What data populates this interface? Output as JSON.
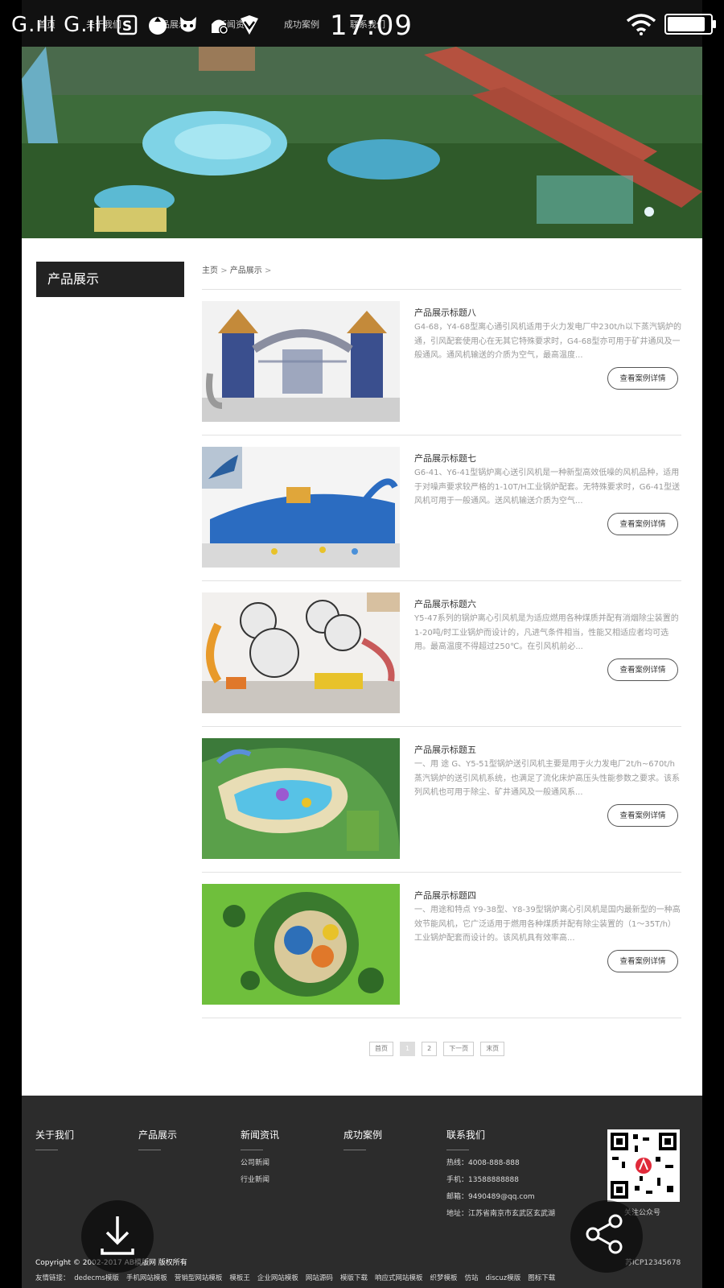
{
  "status_bar": {
    "signal1": "G.ıll",
    "signal2": "G.ıll",
    "time": "17:09",
    "battery_level": 0.95
  },
  "nav": {
    "items": [
      "首页",
      "关于我们",
      "产品展示",
      "新闻资讯",
      "成功案例",
      "联系我们"
    ]
  },
  "sidebar": {
    "title": "产品展示"
  },
  "breadcrumb": {
    "home": "主页",
    "sep": ">",
    "current": "产品展示",
    "trail": ">"
  },
  "products": [
    {
      "title": "产品展示标题八",
      "desc": "G4-68，Y4-68型离心通引风机适用于火力发电厂中230t/h以下蒸汽锅炉的通，引风配套使用心在无其它特殊要求时，G4-68型亦可用于矿井通风及一般通风。通风机输送的介质为空气，最高温度...",
      "button": "查看案例详情"
    },
    {
      "title": "产品展示标题七",
      "desc": "G6-41、Y6-41型锅炉离心送引风机是一种新型高效低噪的风机品种，适用于对噪声要求较严格的1-10T/H工业锅炉配套。无特殊要求时，G6-41型送风机可用于一般通风。送风机输送介质为空气...",
      "button": "查看案例详情"
    },
    {
      "title": "产品展示标题六",
      "desc": "Y5-47系列的锅炉离心引风机是为适应燃用各种煤质并配有消烟除尘装置的1-20吨/时工业锅炉而设计的，凡进气条件相当，性能又相适应者均可选用。最高温度不得超过250℃。在引风机前必...",
      "button": "查看案例详情"
    },
    {
      "title": "产品展示标题五",
      "desc": "一、用 途 G、Y5-51型锅炉送引风机主要是用于火力发电厂2t/h~670t/h蒸汽锅炉的送引风机系统，也满足了流化床炉高压头性能参数之要求。该系列风机也可用于除尘、矿井通风及一般通风系...",
      "button": "查看案例详情"
    },
    {
      "title": "产品展示标题四",
      "desc": "一、用途和特点 Y9-38型、Y8-39型锅炉离心引风机是国内最新型的一种高效节能风机，它广泛适用于燃用各种煤质并配有除尘装置的（1～35T/h）工业锅炉配套而设计的。该风机具有效率高...",
      "button": "查看案例详情"
    }
  ],
  "pagination": [
    "首页",
    "1",
    "2",
    "下一页",
    "末页"
  ],
  "footer": {
    "cols": [
      {
        "heading": "关于我们",
        "items": []
      },
      {
        "heading": "产品展示",
        "items": []
      },
      {
        "heading": "新闻资讯",
        "items": [
          "公司新闻",
          "行业新闻"
        ]
      },
      {
        "heading": "成功案例",
        "items": []
      },
      {
        "heading": "联系我们",
        "items": [
          "热线：4008-888-888",
          "手机：13588888888",
          "邮箱：9490489@qq.com",
          "地址：江苏省南京市玄武区玄武湖"
        ]
      }
    ],
    "qr_label": "关注公众号",
    "copyright": "Copyright © 2002-2017 AB模版网 版权所有",
    "icp": "苏ICP12345678",
    "friend_links_label": "友情链接：",
    "friend_links": [
      "dedecms模版",
      "手机网站模板",
      "营销型网站模板",
      "模板王",
      "企业网站模板",
      "网站源码",
      "模版下载",
      "响应式网站模板",
      "织梦模板",
      "仿站",
      "discuz模版",
      "图标下载"
    ]
  }
}
